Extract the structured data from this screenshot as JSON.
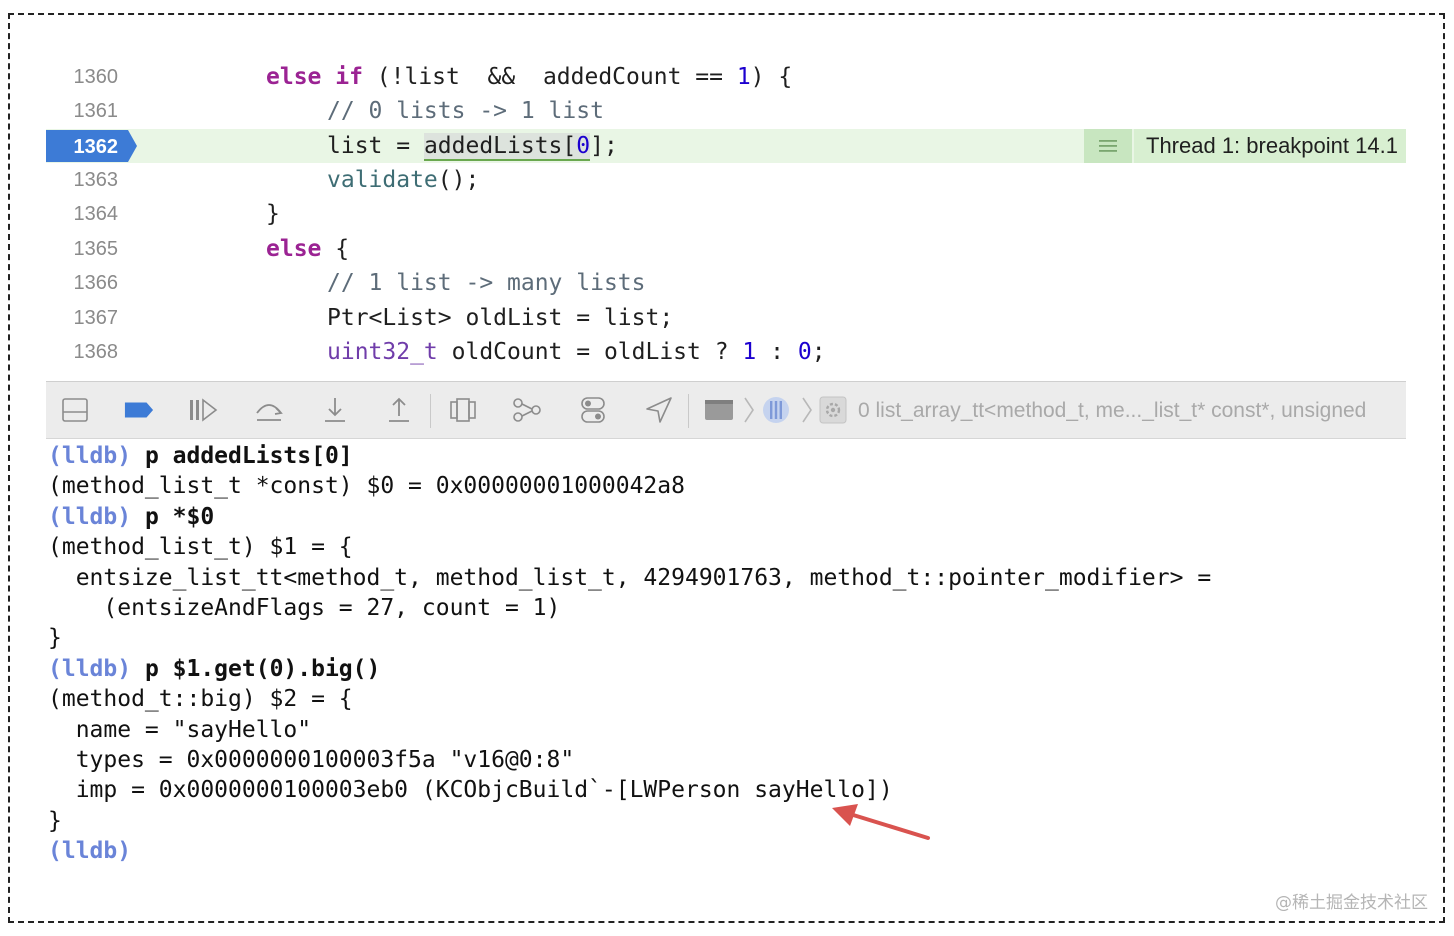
{
  "editor": {
    "lines": [
      {
        "num": "1360",
        "code": [
          "else if",
          " (!list  &&  addedCount == ",
          "1",
          ") {"
        ]
      },
      {
        "num": "1361",
        "code": "// 0 lists -> 1 list"
      },
      {
        "num": "1362",
        "code": [
          "list = ",
          "addedLists",
          "[",
          "0",
          "];"
        ]
      },
      {
        "num": "1363",
        "code": [
          "validate",
          "();"
        ]
      },
      {
        "num": "1364",
        "code": "}"
      },
      {
        "num": "1365",
        "code": [
          "else",
          " {"
        ]
      },
      {
        "num": "1366",
        "code": "// 1 list -> many lists"
      },
      {
        "num": "1367",
        "code": "Ptr<List> oldList = list;"
      },
      {
        "num": "1368",
        "code": [
          "uint32_t",
          " oldCount = oldList ? ",
          "1",
          " : ",
          "0",
          ";"
        ]
      }
    ],
    "current_line": "1362",
    "thread_badge": "Thread 1: breakpoint 14.1"
  },
  "toolbar": {
    "icons": [
      "hide-debug-area-icon",
      "breakpoints-toggle-icon",
      "continue-icon",
      "step-over-icon",
      "step-into-icon",
      "step-out-icon",
      "view-debugger-icon",
      "memory-graph-icon",
      "environment-overrides-icon",
      "simulate-location-icon",
      "process-icon",
      "thread-icon",
      "frame-icon"
    ],
    "breadcrumb": "0 list_array_tt<method_t, me..._list_t* const*, unsigned"
  },
  "console": {
    "lines": [
      {
        "prompt": "(lldb)",
        "text": " p addedLists[0]"
      },
      {
        "text": "(method_list_t *const) $0 = 0x00000001000042a8"
      },
      {
        "prompt": "(lldb)",
        "text": " p *$0"
      },
      {
        "text": "(method_list_t) $1 = {"
      },
      {
        "text": "  entsize_list_tt<method_t, method_list_t, 4294901763, method_t::pointer_modifier> ="
      },
      {
        "text": "    (entsizeAndFlags = 27, count = 1)"
      },
      {
        "text": "}"
      },
      {
        "prompt": "(lldb)",
        "text": " p $1.get(0).big()"
      },
      {
        "text": "(method_t::big) $2 = {"
      },
      {
        "text": "  name = \"sayHello\""
      },
      {
        "text": "  types = 0x0000000100003f5a \"v16@0:8\""
      },
      {
        "text": "  imp = 0x0000000100003eb0 (KCObjcBuild`-[LWPerson sayHello])"
      },
      {
        "text": "}"
      },
      {
        "prompt": "(lldb)",
        "text": ""
      }
    ]
  },
  "annotation_arrow_color": "#d9534f",
  "watermark": "@稀土掘金技术社区"
}
